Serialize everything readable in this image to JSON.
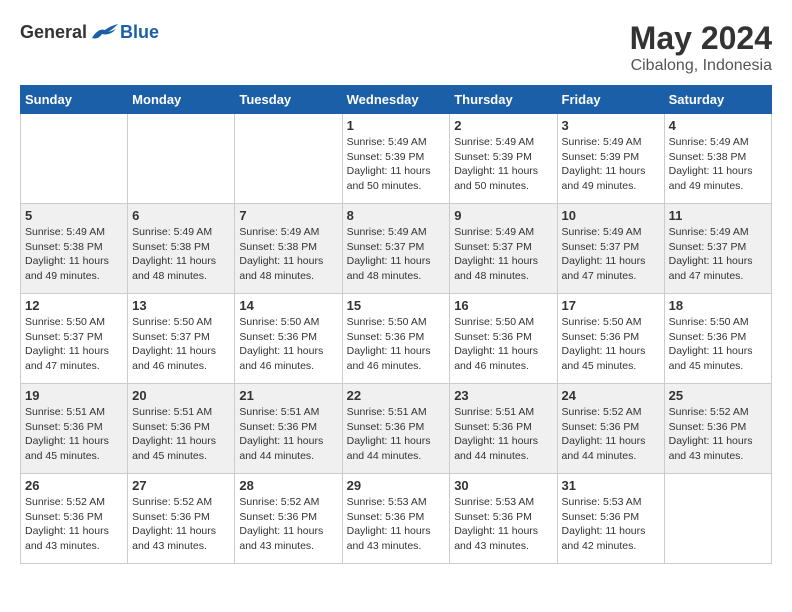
{
  "header": {
    "logo_general": "General",
    "logo_blue": "Blue",
    "month_year": "May 2024",
    "location": "Cibalong, Indonesia"
  },
  "weekdays": [
    "Sunday",
    "Monday",
    "Tuesday",
    "Wednesday",
    "Thursday",
    "Friday",
    "Saturday"
  ],
  "weeks": [
    [
      {
        "day": "",
        "info": ""
      },
      {
        "day": "",
        "info": ""
      },
      {
        "day": "",
        "info": ""
      },
      {
        "day": "1",
        "info": "Sunrise: 5:49 AM\nSunset: 5:39 PM\nDaylight: 11 hours\nand 50 minutes."
      },
      {
        "day": "2",
        "info": "Sunrise: 5:49 AM\nSunset: 5:39 PM\nDaylight: 11 hours\nand 50 minutes."
      },
      {
        "day": "3",
        "info": "Sunrise: 5:49 AM\nSunset: 5:39 PM\nDaylight: 11 hours\nand 49 minutes."
      },
      {
        "day": "4",
        "info": "Sunrise: 5:49 AM\nSunset: 5:38 PM\nDaylight: 11 hours\nand 49 minutes."
      }
    ],
    [
      {
        "day": "5",
        "info": "Sunrise: 5:49 AM\nSunset: 5:38 PM\nDaylight: 11 hours\nand 49 minutes."
      },
      {
        "day": "6",
        "info": "Sunrise: 5:49 AM\nSunset: 5:38 PM\nDaylight: 11 hours\nand 48 minutes."
      },
      {
        "day": "7",
        "info": "Sunrise: 5:49 AM\nSunset: 5:38 PM\nDaylight: 11 hours\nand 48 minutes."
      },
      {
        "day": "8",
        "info": "Sunrise: 5:49 AM\nSunset: 5:37 PM\nDaylight: 11 hours\nand 48 minutes."
      },
      {
        "day": "9",
        "info": "Sunrise: 5:49 AM\nSunset: 5:37 PM\nDaylight: 11 hours\nand 48 minutes."
      },
      {
        "day": "10",
        "info": "Sunrise: 5:49 AM\nSunset: 5:37 PM\nDaylight: 11 hours\nand 47 minutes."
      },
      {
        "day": "11",
        "info": "Sunrise: 5:49 AM\nSunset: 5:37 PM\nDaylight: 11 hours\nand 47 minutes."
      }
    ],
    [
      {
        "day": "12",
        "info": "Sunrise: 5:50 AM\nSunset: 5:37 PM\nDaylight: 11 hours\nand 47 minutes."
      },
      {
        "day": "13",
        "info": "Sunrise: 5:50 AM\nSunset: 5:37 PM\nDaylight: 11 hours\nand 46 minutes."
      },
      {
        "day": "14",
        "info": "Sunrise: 5:50 AM\nSunset: 5:36 PM\nDaylight: 11 hours\nand 46 minutes."
      },
      {
        "day": "15",
        "info": "Sunrise: 5:50 AM\nSunset: 5:36 PM\nDaylight: 11 hours\nand 46 minutes."
      },
      {
        "day": "16",
        "info": "Sunrise: 5:50 AM\nSunset: 5:36 PM\nDaylight: 11 hours\nand 46 minutes."
      },
      {
        "day": "17",
        "info": "Sunrise: 5:50 AM\nSunset: 5:36 PM\nDaylight: 11 hours\nand 45 minutes."
      },
      {
        "day": "18",
        "info": "Sunrise: 5:50 AM\nSunset: 5:36 PM\nDaylight: 11 hours\nand 45 minutes."
      }
    ],
    [
      {
        "day": "19",
        "info": "Sunrise: 5:51 AM\nSunset: 5:36 PM\nDaylight: 11 hours\nand 45 minutes."
      },
      {
        "day": "20",
        "info": "Sunrise: 5:51 AM\nSunset: 5:36 PM\nDaylight: 11 hours\nand 45 minutes."
      },
      {
        "day": "21",
        "info": "Sunrise: 5:51 AM\nSunset: 5:36 PM\nDaylight: 11 hours\nand 44 minutes."
      },
      {
        "day": "22",
        "info": "Sunrise: 5:51 AM\nSunset: 5:36 PM\nDaylight: 11 hours\nand 44 minutes."
      },
      {
        "day": "23",
        "info": "Sunrise: 5:51 AM\nSunset: 5:36 PM\nDaylight: 11 hours\nand 44 minutes."
      },
      {
        "day": "24",
        "info": "Sunrise: 5:52 AM\nSunset: 5:36 PM\nDaylight: 11 hours\nand 44 minutes."
      },
      {
        "day": "25",
        "info": "Sunrise: 5:52 AM\nSunset: 5:36 PM\nDaylight: 11 hours\nand 43 minutes."
      }
    ],
    [
      {
        "day": "26",
        "info": "Sunrise: 5:52 AM\nSunset: 5:36 PM\nDaylight: 11 hours\nand 43 minutes."
      },
      {
        "day": "27",
        "info": "Sunrise: 5:52 AM\nSunset: 5:36 PM\nDaylight: 11 hours\nand 43 minutes."
      },
      {
        "day": "28",
        "info": "Sunrise: 5:52 AM\nSunset: 5:36 PM\nDaylight: 11 hours\nand 43 minutes."
      },
      {
        "day": "29",
        "info": "Sunrise: 5:53 AM\nSunset: 5:36 PM\nDaylight: 11 hours\nand 43 minutes."
      },
      {
        "day": "30",
        "info": "Sunrise: 5:53 AM\nSunset: 5:36 PM\nDaylight: 11 hours\nand 43 minutes."
      },
      {
        "day": "31",
        "info": "Sunrise: 5:53 AM\nSunset: 5:36 PM\nDaylight: 11 hours\nand 42 minutes."
      },
      {
        "day": "",
        "info": ""
      }
    ]
  ]
}
